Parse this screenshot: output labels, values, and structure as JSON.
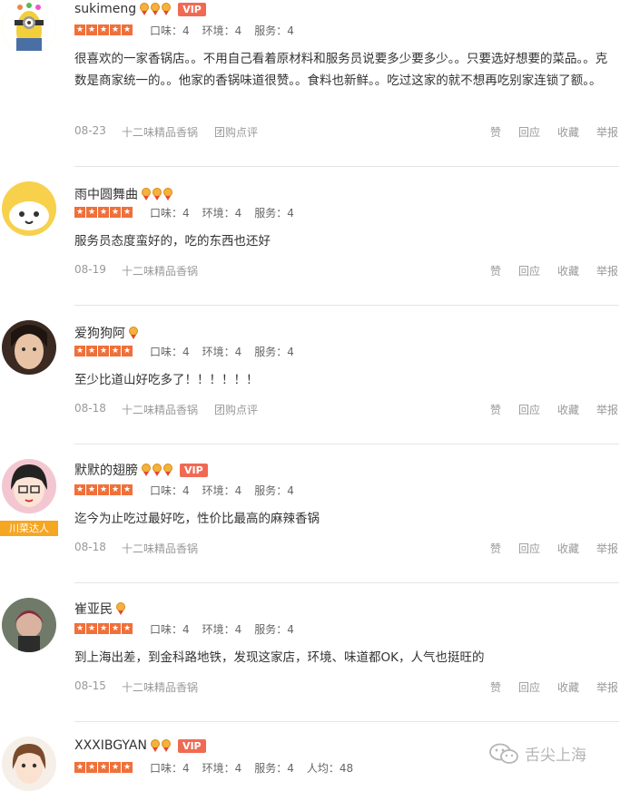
{
  "reviews": [
    {
      "name": "sukimeng",
      "medals": 3,
      "vip": "VIP",
      "scores": [
        "口味：4",
        "环境：4",
        "服务：4"
      ],
      "content": "很喜欢的一家香锅店。。不用自己看着原材料和服务员说要多少要多少。。只要选好想要的菜品。。克数是商家统一的。。他家的香锅味道很赞。。食料也新鲜。。吃过这家的就不想再吃别家连锁了额。。",
      "date": "08-23",
      "source": "十二味精品香锅",
      "source2": "团购点评"
    },
    {
      "name": "雨中圆舞曲",
      "medals": 3,
      "vip": "",
      "scores": [
        "口味：4",
        "环境：4",
        "服务：4"
      ],
      "content": "服务员态度蛮好的，吃的东西也还好",
      "date": "08-19",
      "source": "十二味精品香锅",
      "source2": ""
    },
    {
      "name": "爱狗狗阿",
      "medals": 1,
      "vip": "",
      "scores": [
        "口味：4",
        "环境：4",
        "服务：4"
      ],
      "content": "至少比道山好吃多了！！！！！！",
      "date": "08-18",
      "source": "十二味精品香锅",
      "source2": "团购点评"
    },
    {
      "name": "默默的翅膀",
      "medals": 3,
      "vip": "VIP",
      "tag": "川菜达人",
      "scores": [
        "口味：4",
        "环境：4",
        "服务：4"
      ],
      "content": "迄今为止吃过最好吃，性价比最高的麻辣香锅",
      "date": "08-18",
      "source": "十二味精品香锅",
      "source2": ""
    },
    {
      "name": "崔亚民",
      "medals": 1,
      "vip": "",
      "scores": [
        "口味：4",
        "环境：4",
        "服务：4"
      ],
      "content": "到上海出差，到金科路地铁，发现这家店，环境、味道都OK，人气也挺旺的",
      "date": "08-15",
      "source": "十二味精品香锅",
      "source2": ""
    },
    {
      "name": "XXXIBGYAN",
      "medals": 2,
      "vip": "VIP",
      "scores": [
        "口味：4",
        "环境：4",
        "服务：4",
        "人均：48"
      ],
      "content": "",
      "date": "",
      "source": "",
      "source2": ""
    }
  ],
  "actions": [
    "赞",
    "回应",
    "收藏",
    "举报"
  ],
  "watermark": "舌尖上海",
  "icons": {
    "watermark": "wechat-icon",
    "medal": "medal-icon",
    "star": "star-icon"
  },
  "colors": {
    "star": "#f0703a",
    "vip": "#f06a53",
    "meta": "#999999",
    "tag": "#f5a623"
  }
}
